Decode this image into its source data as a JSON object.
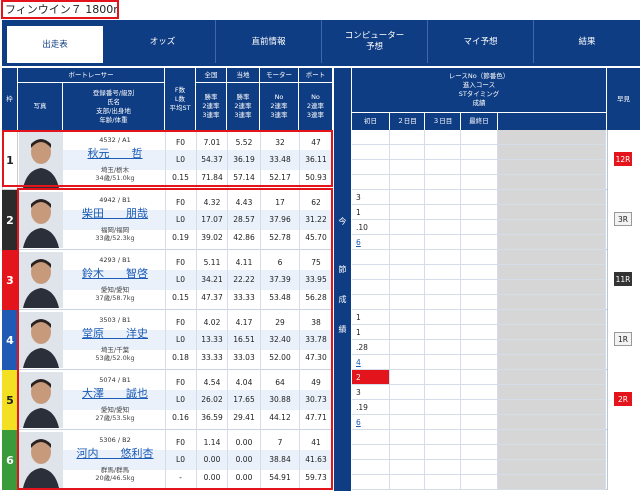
{
  "race_title": "フィンウイン７ 1800m",
  "tabs": [
    "出走表",
    "オッズ",
    "直前情報",
    "コンピューター\n予想",
    "マイ予想",
    "結果"
  ],
  "header": {
    "waku": "枠",
    "racer": "ボートレーサー",
    "photo": "写真",
    "racer_info": "登録番号/級別\n氏名\n支部/出身地\n年齢/体重",
    "f_l_st": "F数\nL数\n平均ST",
    "zenkoku": "全国",
    "tochi": "当地",
    "motor": "モーター",
    "boat": "ボート",
    "rate_zenkoku": "勝率\n2連率\n3連率",
    "rate_tochi": "勝率\n2連率\n3連率",
    "rate_motor": "No\n2連率\n3連率",
    "rate_boat": "No\n2連率\n3連率",
    "race_info": "レースNo（節番色）\n進入コース\nSTタイミング\n成績",
    "days": [
      "初日",
      "２日目",
      "３日目",
      "最終日"
    ],
    "hayami": "早見"
  },
  "side_label": [
    "今",
    "節",
    "成",
    "績"
  ],
  "racers": [
    {
      "waku": "1",
      "regno": "4532 / A1",
      "name": "秋元　　哲",
      "branch": "埼玉/栃木",
      "age": "34歳/51.0kg",
      "f": "F0",
      "l": "L0",
      "st": "0.15",
      "zenkoku": [
        "7.01",
        "54.37",
        "71.84"
      ],
      "tochi": [
        "5.52",
        "36.19",
        "57.14"
      ],
      "motor": [
        "32",
        "33.48",
        "52.17"
      ],
      "boat": [
        "47",
        "36.11",
        "50.93"
      ],
      "series": [],
      "hayami": "12R"
    },
    {
      "waku": "2",
      "regno": "4942 / B1",
      "name": "柴田　　朋哉",
      "branch": "福岡/福岡",
      "age": "33歳/52.3kg",
      "f": "F0",
      "l": "L0",
      "st": "0.19",
      "zenkoku": [
        "4.32",
        "17.07",
        "39.02"
      ],
      "tochi": [
        "4.43",
        "28.57",
        "42.86"
      ],
      "motor": [
        "17",
        "37.96",
        "52.78"
      ],
      "boat": [
        "62",
        "31.22",
        "45.70"
      ],
      "series": [
        "3",
        "1",
        ".10",
        "6"
      ],
      "hayami": "3R"
    },
    {
      "waku": "3",
      "regno": "4293 / B1",
      "name": "鈴木　　智啓",
      "branch": "愛知/愛知",
      "age": "37歳/58.7kg",
      "f": "F0",
      "l": "L0",
      "st": "0.15",
      "zenkoku": [
        "5.11",
        "34.21",
        "47.37"
      ],
      "tochi": [
        "4.11",
        "22.22",
        "33.33"
      ],
      "motor": [
        "6",
        "37.39",
        "53.48"
      ],
      "boat": [
        "75",
        "33.95",
        "56.28"
      ],
      "series": [],
      "hayami": "11R"
    },
    {
      "waku": "4",
      "regno": "3503 / B1",
      "name": "堂原　　洋史",
      "branch": "埼玉/千葉",
      "age": "53歳/52.0kg",
      "f": "F0",
      "l": "L0",
      "st": "0.18",
      "zenkoku": [
        "4.02",
        "13.33",
        "33.33"
      ],
      "tochi": [
        "4.17",
        "16.51",
        "33.03"
      ],
      "motor": [
        "29",
        "32.40",
        "52.00"
      ],
      "boat": [
        "38",
        "33.78",
        "47.30"
      ],
      "series": [
        "1",
        "1",
        ".28",
        "4"
      ],
      "hayami": "1R"
    },
    {
      "waku": "5",
      "regno": "5074 / B1",
      "name": "大澤　　誠也",
      "branch": "愛知/愛知",
      "age": "27歳/53.5kg",
      "f": "F0",
      "l": "L0",
      "st": "0.16",
      "zenkoku": [
        "4.54",
        "26.02",
        "36.59"
      ],
      "tochi": [
        "4.04",
        "17.65",
        "29.41"
      ],
      "motor": [
        "64",
        "30.88",
        "44.12"
      ],
      "boat": [
        "49",
        "30.73",
        "47.71"
      ],
      "series": [
        "2",
        "3",
        ".19",
        "6"
      ],
      "hayami": "2R"
    },
    {
      "waku": "6",
      "regno": "5306 / B2",
      "name": "河内　　悠利杏",
      "branch": "群馬/群馬",
      "age": "20歳/46.5kg",
      "f": "F0",
      "l": "L0",
      "st": "-",
      "zenkoku": [
        "1.14",
        "0.00",
        "0.00"
      ],
      "tochi": [
        "0.00",
        "0.00",
        "0.00"
      ],
      "motor": [
        "7",
        "38.84",
        "54.91"
      ],
      "boat": [
        "41",
        "41.63",
        "59.73"
      ],
      "series": [],
      "hayami": ""
    }
  ],
  "colors": {
    "navy": "#0f3d84",
    "highlight_red": "#e3141b",
    "waku_colors": [
      "#ffffff",
      "#2b2b2b",
      "#e3141b",
      "#1f5ab5",
      "#f4e022",
      "#3a9b3a"
    ],
    "waku_text": [
      "#222222",
      "#ffffff",
      "#ffffff",
      "#ffffff",
      "#222222",
      "#ffffff"
    ]
  }
}
